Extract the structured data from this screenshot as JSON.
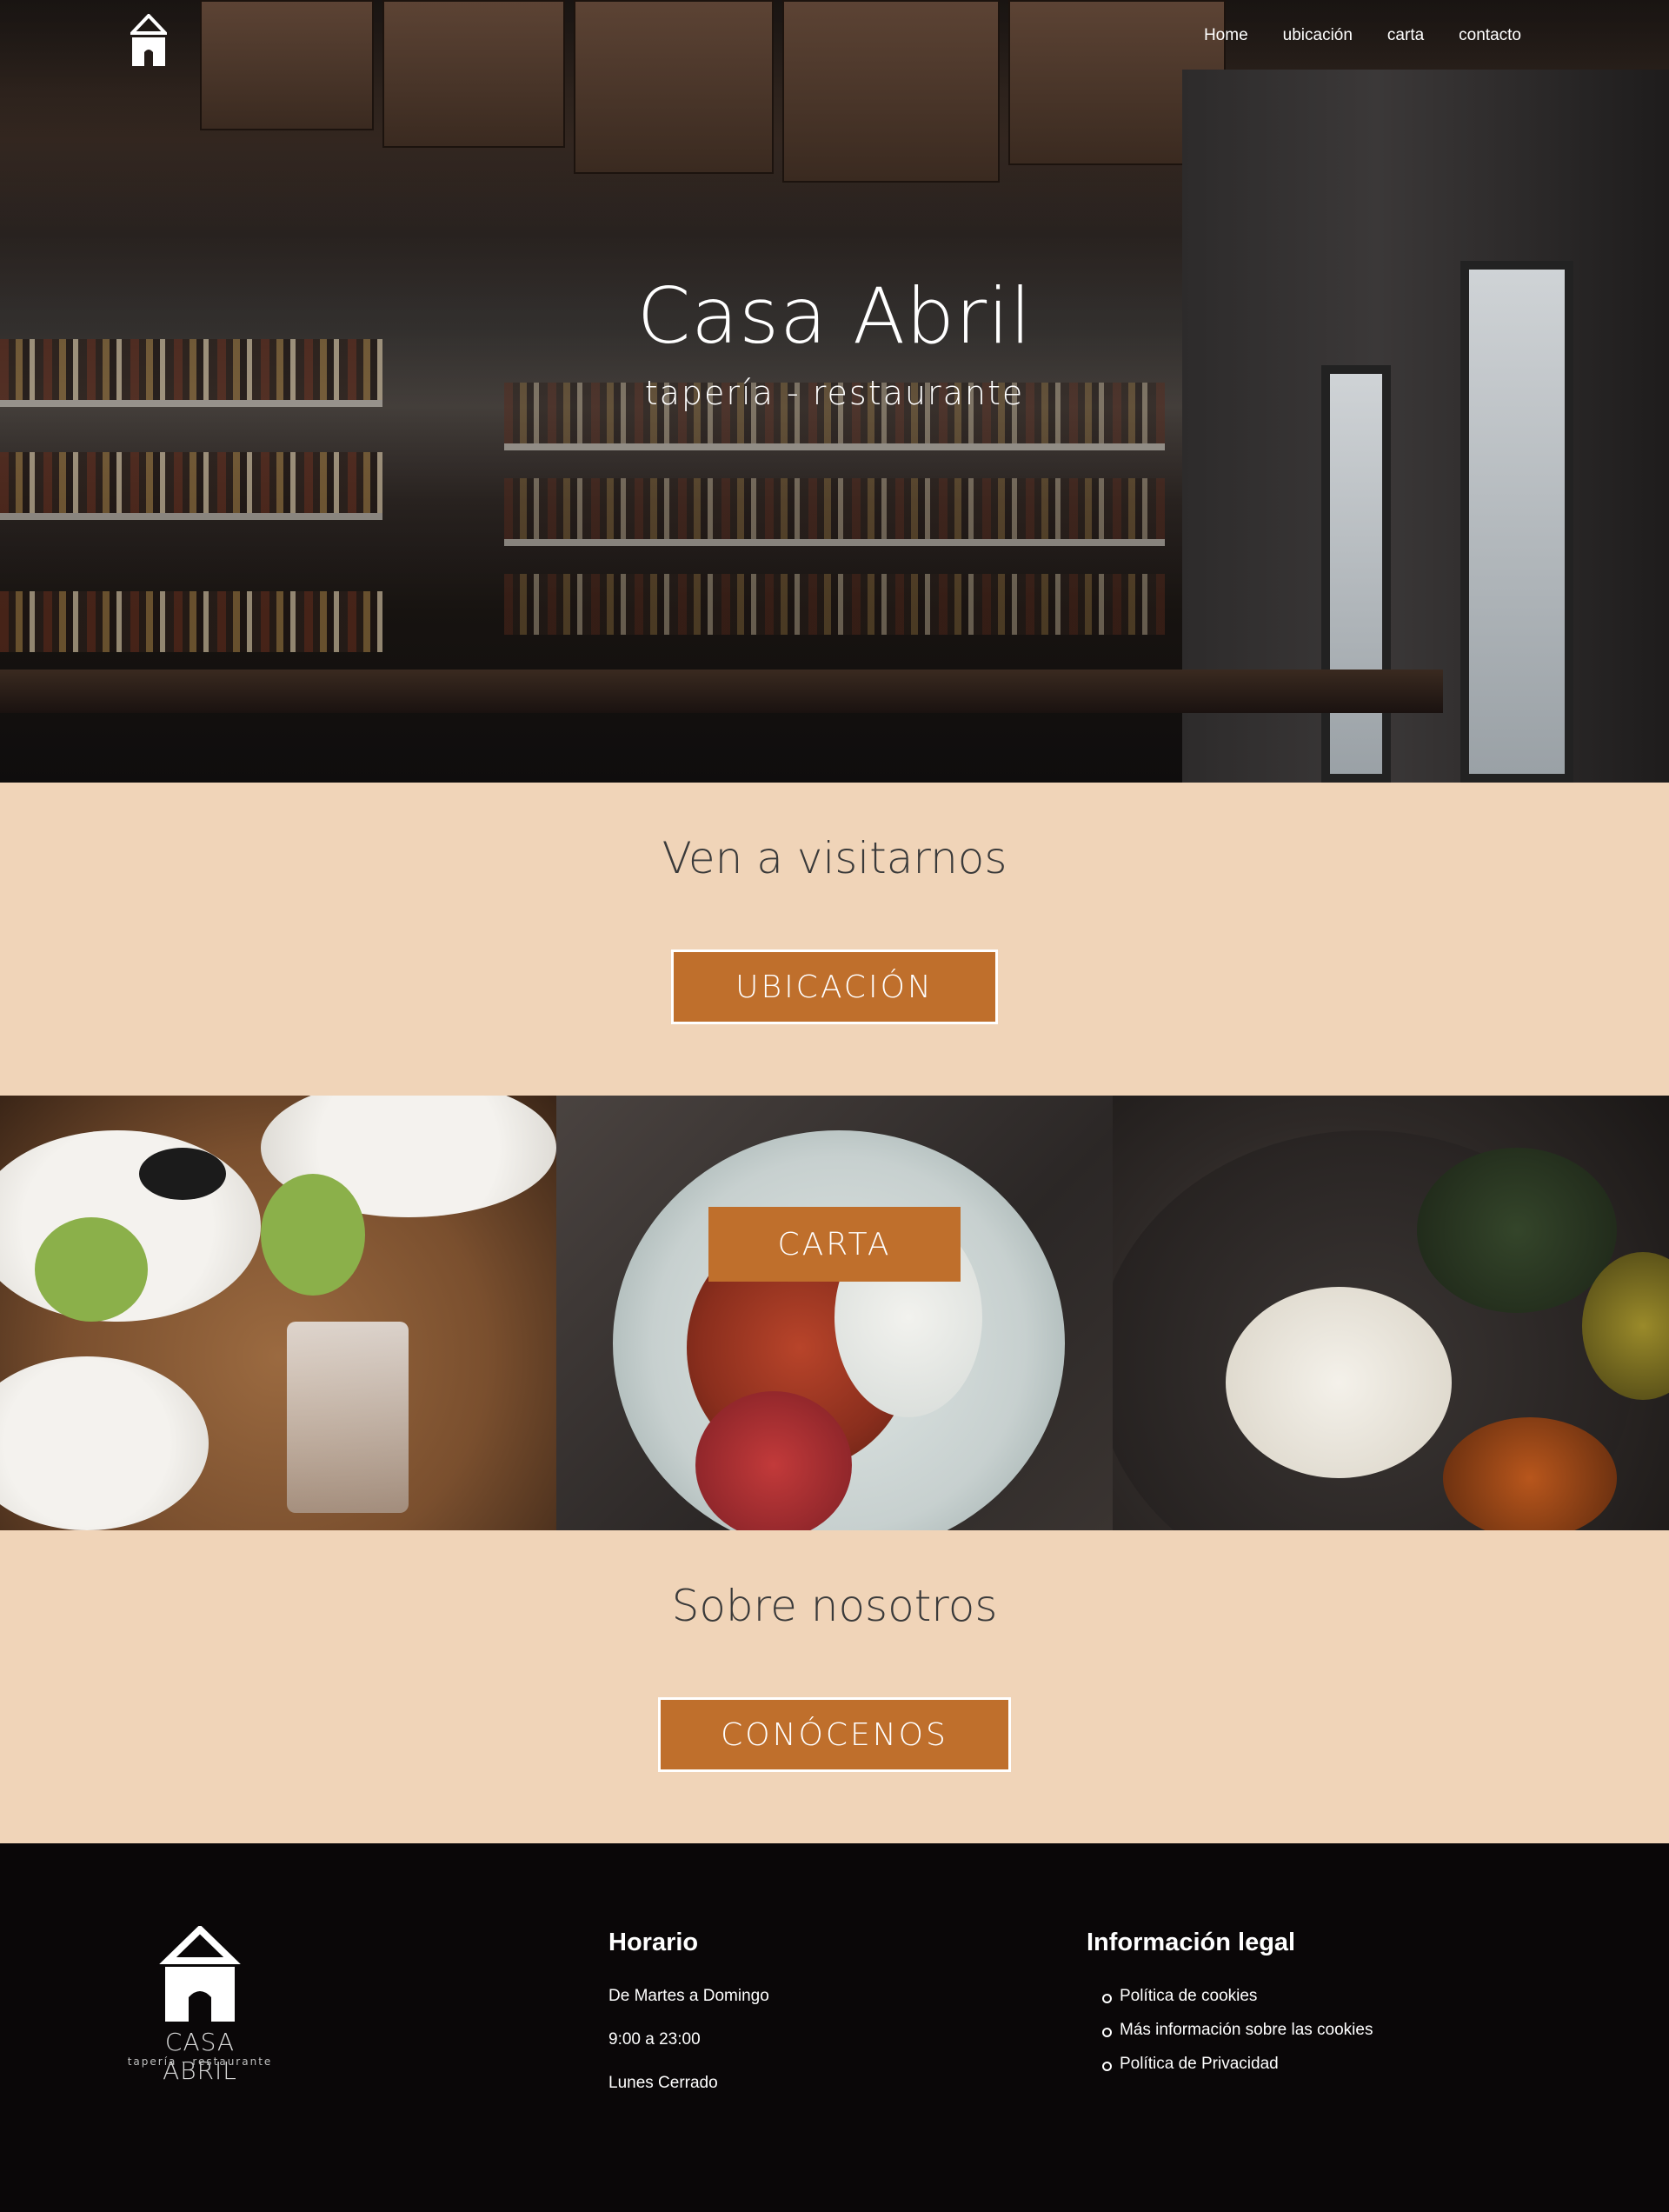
{
  "nav": {
    "logo_icon": "house-logo-icon",
    "links": [
      "Home",
      "ubicación",
      "carta",
      "contacto"
    ]
  },
  "hero": {
    "title": "Casa Abril",
    "subtitle": "tapería - restaurante"
  },
  "visit": {
    "heading": "Ven a visitarnos",
    "button": "UBICACIÓN"
  },
  "menu": {
    "button": "CARTA"
  },
  "about": {
    "heading": "Sobre nosotros",
    "button": "CONÓCENOS"
  },
  "footer": {
    "logo": {
      "name": "CASA ABRIL",
      "tagline": "tapería - restaurante"
    },
    "hours": {
      "title": "Horario",
      "lines": [
        "De Martes a Domingo",
        "9:00 a 23:00",
        "Lunes Cerrado"
      ]
    },
    "legal": {
      "title": "Información legal",
      "links": [
        "Política de cookies",
        "Más información sobre las cookies",
        "Política de Privacidad"
      ]
    }
  },
  "colors": {
    "band_bg": "#f0d4b8",
    "button_bg": "#bf6f2c",
    "footer_bg": "#0a0708"
  }
}
